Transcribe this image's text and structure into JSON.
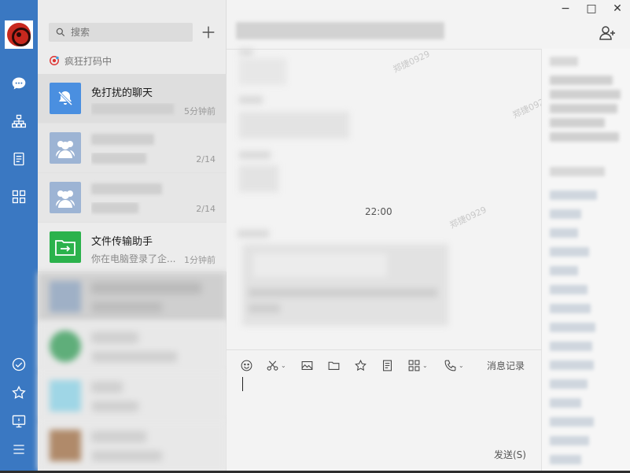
{
  "search": {
    "placeholder": "搜索"
  },
  "status": {
    "text": "疯狂打码中"
  },
  "chats": [
    {
      "name": "免打扰的聊天",
      "preview": "",
      "time": "5分钟前"
    },
    {
      "name": "",
      "preview": "",
      "time": "2/14"
    },
    {
      "name": "",
      "preview": "",
      "time": "2/14"
    },
    {
      "name": "文件传输助手",
      "preview": "你在电脑登录了企...",
      "time": "1分钟前"
    }
  ],
  "conversation": {
    "time_divider": "22:00",
    "watermark": "郑捷0929"
  },
  "toolbar": {
    "history_label": "消息记录"
  },
  "composer": {
    "send_label": "发送(S)"
  },
  "window": {
    "minimize": "−",
    "maximize": "□",
    "close": "✕"
  }
}
